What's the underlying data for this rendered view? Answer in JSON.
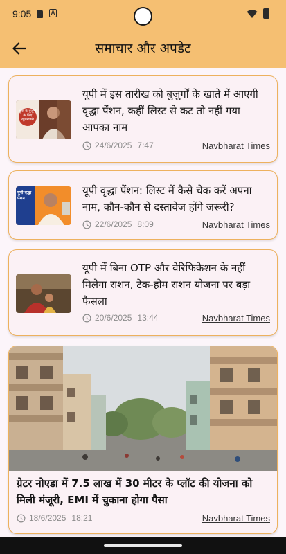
{
  "status_bar": {
    "time": "9:05",
    "notification_letter": "A"
  },
  "header": {
    "title": "समाचार और अपडेट"
  },
  "articles": [
    {
      "headline": "यूपी में इस तारीख को बुजुर्गों के खाते में आएगी वृद्धा पेंशन, कहीं लिस्ट से कट तो नहीं गया आपका नाम",
      "date": "24/6/2025",
      "time": "7:47",
      "source": "Navbharat Times",
      "thumb_text": "यूपी के बुजुर्गों के लिए खुशखबरी"
    },
    {
      "headline": "यूपी वृद्धा पेंशन: लिस्ट में कैसे चेक करें अपना नाम, कौन-कौन से दस्तावेज होंगे जरूरी?",
      "date": "22/6/2025",
      "time": "8:09",
      "source": "Navbharat Times",
      "thumb_text": "यूपी वृद्धा पेंशन"
    },
    {
      "headline": "यूपी में बिना OTP और वेरिफिकेशन के नहीं मिलेगा राशन, टेक-होम राशन योजना पर बड़ा फैसला",
      "date": "20/6/2025",
      "time": "13:44",
      "source": "Navbharat Times"
    },
    {
      "headline": "ग्रेटर नोएडा में 7.5 लाख में 30 मीटर के प्लॉट की योजना को मिली मंजूरी, EMI में चुकाना होगा पैसा",
      "date": "18/6/2025",
      "time": "18:21",
      "source": "Navbharat Times"
    }
  ],
  "colors": {
    "app_bar": "#F5BF72",
    "card_border": "#EDB15E",
    "background": "#FCF5FA"
  }
}
